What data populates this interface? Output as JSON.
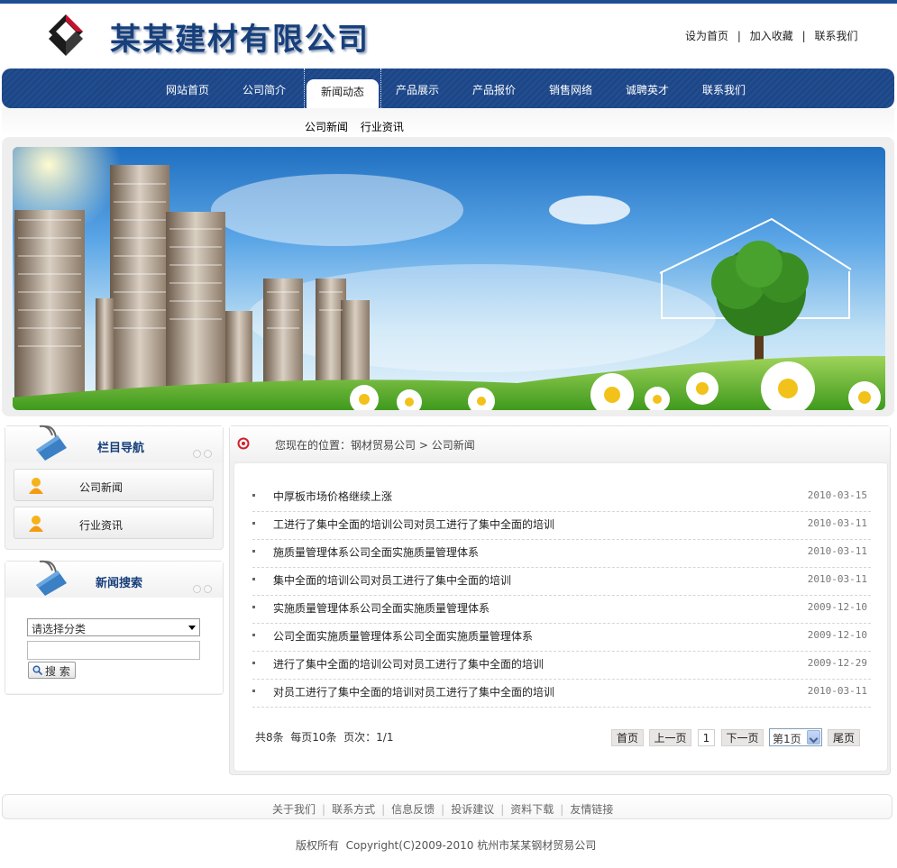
{
  "header": {
    "company_name": "某某建材有限公司",
    "top_links": [
      "设为首页",
      "加入收藏",
      "联系我们"
    ],
    "top_link_sep": "|"
  },
  "nav": {
    "items": [
      "网站首页",
      "公司简介",
      "新闻动态",
      "产品展示",
      "产品报价",
      "销售网络",
      "诚聘英才",
      "联系我们"
    ],
    "active": "新闻动态",
    "sub_items": [
      "公司新闻",
      "行业资讯"
    ]
  },
  "sidebar": {
    "column_nav": {
      "title": "栏目导航",
      "items": [
        "公司新闻",
        "行业资讯"
      ]
    },
    "news_search": {
      "title": "新闻搜索",
      "select_value": "请选择分类",
      "input_value": "",
      "button_label": "搜 索"
    }
  },
  "breadcrumb": {
    "prefix": "您现在的位置：",
    "home": "钢材贸易公司",
    "sep": " > ",
    "current": "公司新闻"
  },
  "news_list": [
    {
      "title": "中厚板市场价格继续上涨",
      "date": "2010-03-15"
    },
    {
      "title": "工进行了集中全面的培训公司对员工进行了集中全面的培训",
      "date": "2010-03-11"
    },
    {
      "title": "施质量管理体系公司全面实施质量管理体系",
      "date": "2010-03-11"
    },
    {
      "title": "集中全面的培训公司对员工进行了集中全面的培训",
      "date": "2010-03-11"
    },
    {
      "title": "实施质量管理体系公司全面实施质量管理体系",
      "date": "2009-12-10"
    },
    {
      "title": "公司全面实施质量管理体系公司全面实施质量管理体系",
      "date": "2009-12-10"
    },
    {
      "title": "进行了集中全面的培训公司对员工进行了集中全面的培训",
      "date": "2009-12-29"
    },
    {
      "title": "对员工进行了集中全面的培训对员工进行了集中全面的培训",
      "date": "2010-03-11"
    }
  ],
  "pagination": {
    "info": "共8条  每页10条  页次：1/1",
    "first": "首页",
    "prev": "上一页",
    "current": "1",
    "next": "下一页",
    "page_select": "第1页",
    "last": "尾页"
  },
  "footer": {
    "links": [
      "关于我们",
      "联系方式",
      "信息反馈",
      "投诉建议",
      "资料下载",
      "友情链接"
    ],
    "link_sep": "|",
    "copyright": "版权所有  Copyright(C)2009-2010 杭州市某某钢材贸易公司"
  },
  "colors": {
    "brand_blue": "#1d4686",
    "title_blue": "#173f7b",
    "logo_red": "#c8102e"
  }
}
